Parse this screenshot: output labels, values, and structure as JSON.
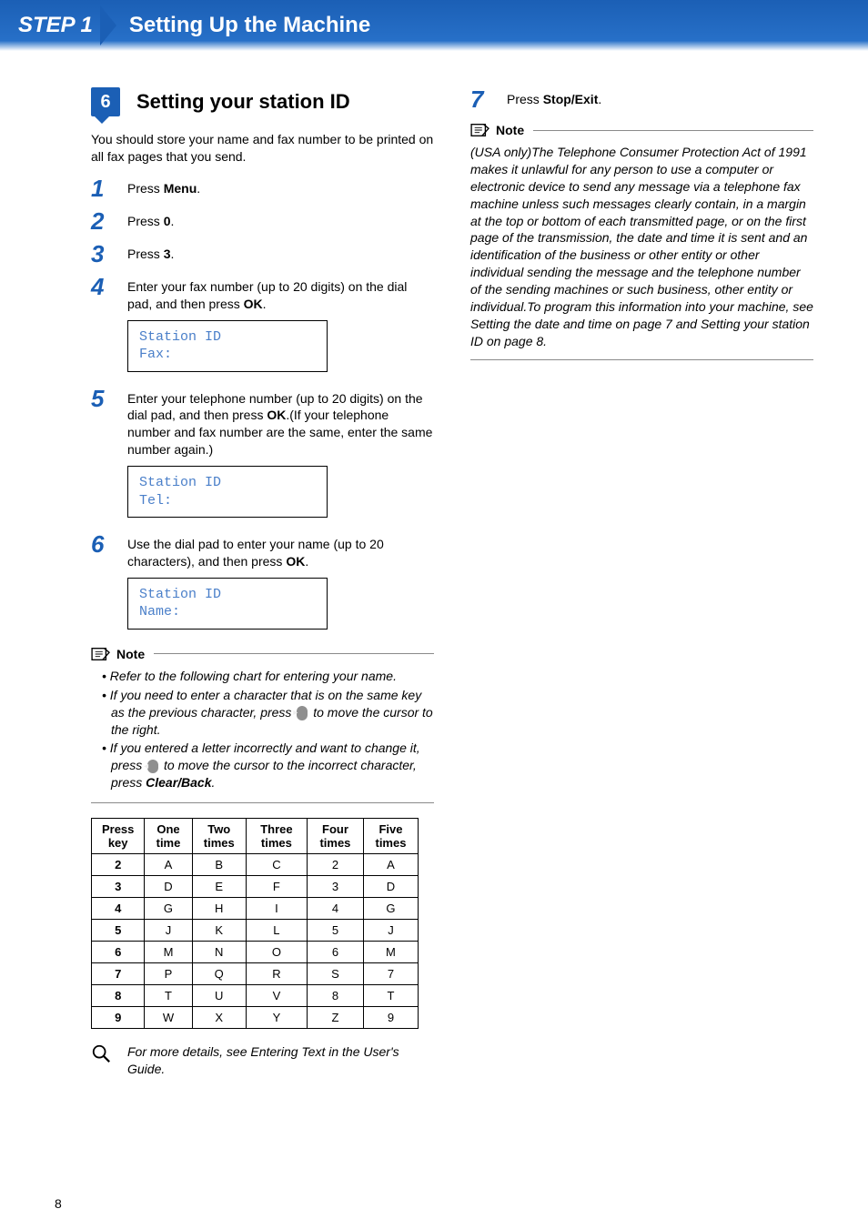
{
  "header": {
    "step_label": "STEP 1",
    "title": "Setting Up the Machine"
  },
  "section": {
    "number": "6",
    "title": "Setting your station ID",
    "intro": "You should store your name and fax number to be printed on all fax pages that you send."
  },
  "steps": {
    "s1": {
      "num": "1",
      "pre": "Press ",
      "key": "Menu",
      "post": "."
    },
    "s2": {
      "num": "2",
      "pre": "Press ",
      "key": "0",
      "post": "."
    },
    "s3": {
      "num": "3",
      "pre": "Press ",
      "key": "3",
      "post": "."
    },
    "s4": {
      "num": "4",
      "text_a": "Enter your fax number (up to 20 digits) on the dial pad, and then press ",
      "key": "OK",
      "text_b": ".",
      "lcd": "Station ID\nFax:"
    },
    "s5": {
      "num": "5",
      "text_a": "Enter your telephone number (up to 20 digits) on the dial pad, and then press ",
      "key": "OK",
      "text_b": ".(If your telephone number and fax number are the same, enter the same number again.)",
      "lcd": "Station ID\nTel:"
    },
    "s6": {
      "num": "6",
      "text_a": "Use the dial pad to enter your name (up to 20 characters), and then press ",
      "key": "OK",
      "text_b": ".",
      "lcd": "Station ID\nName:"
    },
    "s7": {
      "num": "7",
      "pre": "Press ",
      "key": "Stop/Exit",
      "post": "."
    }
  },
  "note1": {
    "label": "Note",
    "li1": "Refer to the following chart for entering your name.",
    "li2a": "If you need to enter a character that is on the same key as the previous character, press ",
    "li2_icon": "▸",
    "li2b": " to move the cursor to the right.",
    "li3a": "If you entered a letter incorrectly and want to change it, press ",
    "li3_icon": "◂",
    "li3b": " to move the cursor to the incorrect character, press ",
    "li3_key": "Clear/Back",
    "li3c": "."
  },
  "chart_data": {
    "type": "table",
    "headers": [
      "Press key",
      "One time",
      "Two times",
      "Three times",
      "Four times",
      "Five times"
    ],
    "rows": [
      [
        "2",
        "A",
        "B",
        "C",
        "2",
        "A"
      ],
      [
        "3",
        "D",
        "E",
        "F",
        "3",
        "D"
      ],
      [
        "4",
        "G",
        "H",
        "I",
        "4",
        "G"
      ],
      [
        "5",
        "J",
        "K",
        "L",
        "5",
        "J"
      ],
      [
        "6",
        "M",
        "N",
        "O",
        "6",
        "M"
      ],
      [
        "7",
        "P",
        "Q",
        "R",
        "S",
        "7"
      ],
      [
        "8",
        "T",
        "U",
        "V",
        "8",
        "T"
      ],
      [
        "9",
        "W",
        "X",
        "Y",
        "Z",
        "9"
      ]
    ]
  },
  "ref": {
    "text": "For more details, see Entering Text in the User's Guide."
  },
  "note2": {
    "label": "Note",
    "text": "(USA only)The Telephone Consumer Protection Act of 1991 makes it unlawful for any person to use a computer or electronic device to send any message via a telephone fax machine unless such messages clearly contain, in a margin at the top or bottom of each transmitted page, or on the first page of the transmission, the date and time it is sent and an identification of the business or other entity or other individual sending the message and the telephone number of the sending machines or such business, other entity or individual.To program this information into your machine, see Setting the date and time on page 7 and Setting your station ID on page 8."
  },
  "page_number": "8"
}
